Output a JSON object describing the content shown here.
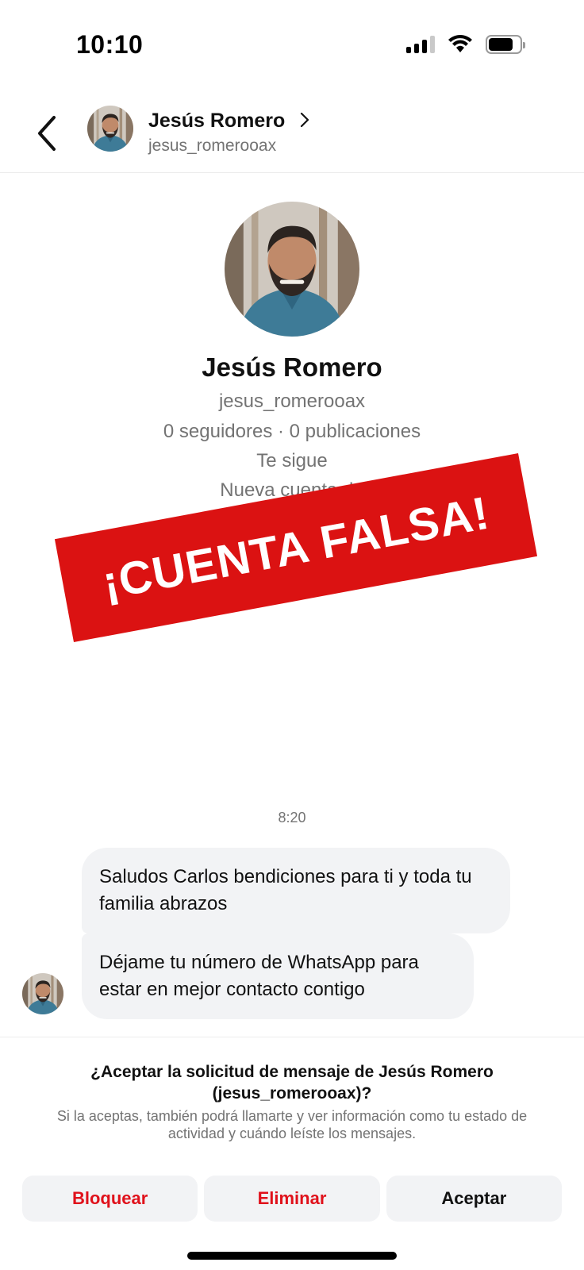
{
  "status_bar": {
    "time": "10:10",
    "signal_icon": "cellular-signal-icon",
    "wifi_icon": "wifi-icon",
    "battery_icon": "battery-icon"
  },
  "header": {
    "back_icon": "chevron-left-icon",
    "name": "Jesús Romero",
    "username": "jesus_romerooax",
    "chevron_icon": "chevron-right-icon"
  },
  "profile": {
    "name": "Jesús Romero",
    "username": "jesus_romerooax",
    "stats": "0 seguidores · 0 publicaciones",
    "follows_you": "Te sigue",
    "new_account": "Nueva cuenta de"
  },
  "overlay": {
    "text": "¡CUENTA FALSA!",
    "color": "#db1212"
  },
  "messages": {
    "time": "8:20",
    "items": [
      {
        "text": "Saludos Carlos bendiciones para ti y toda tu familia abrazos"
      },
      {
        "text": "Déjame tu número de WhatsApp para estar en mejor contacto contigo"
      }
    ]
  },
  "request": {
    "title": "¿Aceptar la solicitud de mensaje de Jesús Romero (jesus_romerooax)?",
    "description": "Si la aceptas, también podrá llamarte y ver información como tu estado de actividad y cuándo leíste los mensajes.",
    "buttons": {
      "block": "Bloquear",
      "delete": "Eliminar",
      "accept": "Aceptar"
    }
  },
  "colors": {
    "danger": "#e0111b",
    "bubble": "#f2f3f5",
    "muted_text": "#737373"
  }
}
